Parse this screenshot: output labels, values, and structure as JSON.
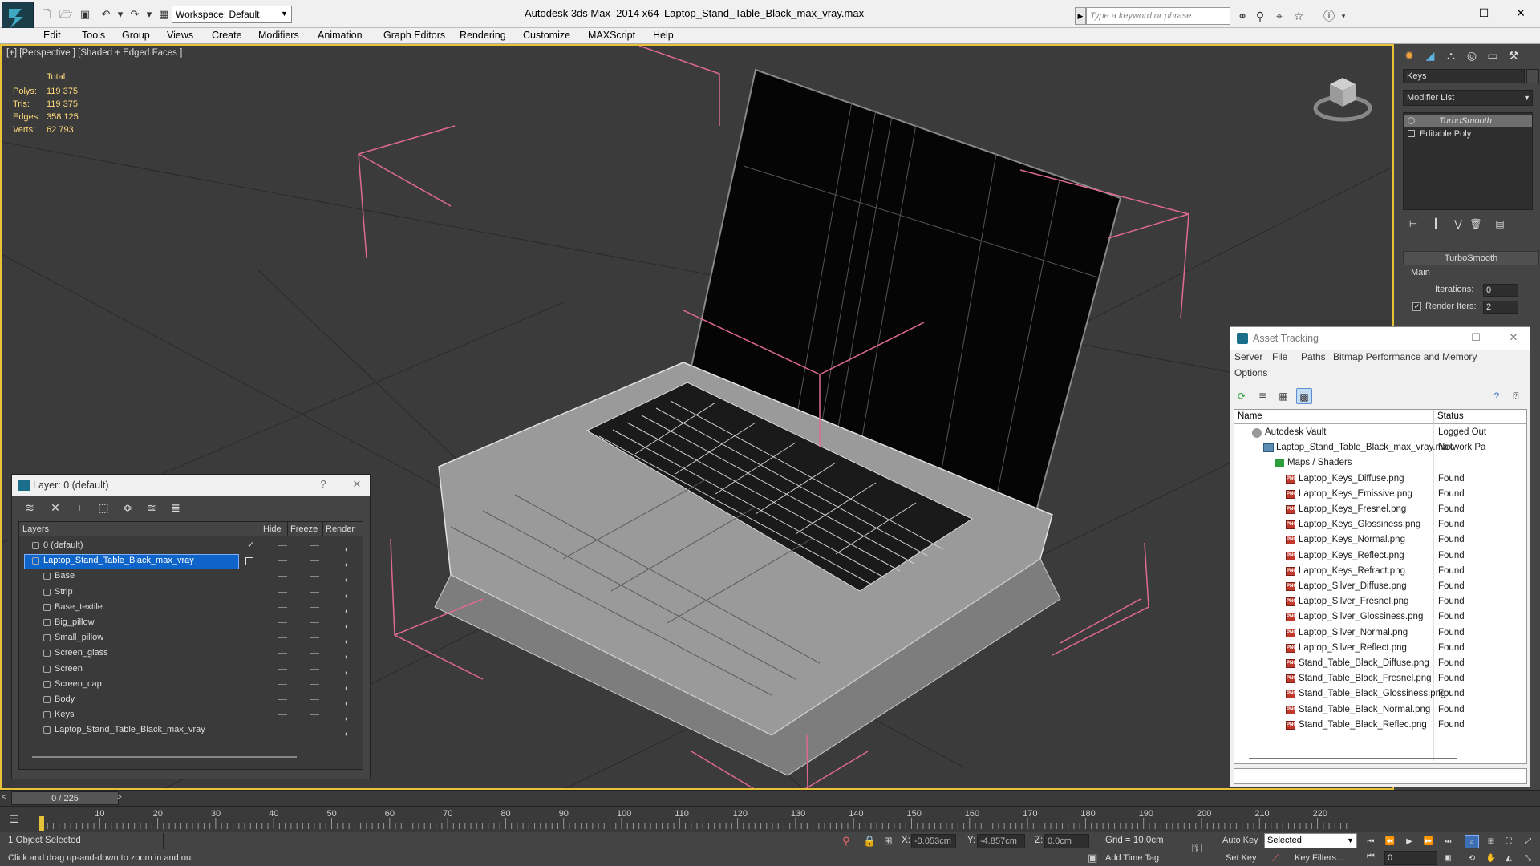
{
  "window": {
    "app_title": "Autodesk 3ds Max  2014 x64",
    "file_title": "Laptop_Stand_Table_Black_max_vray.max",
    "workspace": "Workspace: Default",
    "search_placeholder": "Type a keyword or phrase"
  },
  "menu": [
    "Edit",
    "Tools",
    "Group",
    "Views",
    "Create",
    "Modifiers",
    "Animation",
    "Graph Editors",
    "Rendering",
    "Customize",
    "MAXScript",
    "Help"
  ],
  "viewport": {
    "label": "[+] [Perspective ] [Shaded + Edged Faces ]",
    "stats_header": "Total",
    "stats": [
      {
        "label": "Polys:",
        "value": "119 375"
      },
      {
        "label": "Tris:",
        "value": "119 375"
      },
      {
        "label": "Edges:",
        "value": "358 125"
      },
      {
        "label": "Verts:",
        "value": "62 793"
      }
    ]
  },
  "command_panel": {
    "keys_field": "Keys",
    "modifier_list": "Modifier List",
    "stack": [
      "TurboSmooth",
      "Editable Poly"
    ],
    "rollout_title": "TurboSmooth",
    "group_main": "Main",
    "iterations_label": "Iterations:",
    "iterations_value": "0",
    "render_iters_label": "Render Iters:",
    "render_iters_value": "2"
  },
  "asset_tracking": {
    "title": "Asset Tracking",
    "menu_row1": [
      "Server",
      "File",
      "Paths",
      "Bitmap Performance and Memory"
    ],
    "menu_row2": [
      "Options"
    ],
    "col_name": "Name",
    "col_status": "Status",
    "rows": [
      {
        "name": "Autodesk Vault",
        "status": "Logged Out",
        "kind": "vault",
        "indent": 0
      },
      {
        "name": "Laptop_Stand_Table_Black_max_vray.max",
        "status": "Network Pa",
        "kind": "max",
        "indent": 1
      },
      {
        "name": "Maps / Shaders",
        "status": "",
        "kind": "folder",
        "indent": 2
      },
      {
        "name": "Laptop_Keys_Diffuse.png",
        "status": "Found",
        "kind": "png",
        "indent": 3
      },
      {
        "name": "Laptop_Keys_Emissive.png",
        "status": "Found",
        "kind": "png",
        "indent": 3
      },
      {
        "name": "Laptop_Keys_Fresnel.png",
        "status": "Found",
        "kind": "png",
        "indent": 3
      },
      {
        "name": "Laptop_Keys_Glossiness.png",
        "status": "Found",
        "kind": "png",
        "indent": 3
      },
      {
        "name": "Laptop_Keys_Normal.png",
        "status": "Found",
        "kind": "png",
        "indent": 3
      },
      {
        "name": "Laptop_Keys_Reflect.png",
        "status": "Found",
        "kind": "png",
        "indent": 3
      },
      {
        "name": "Laptop_Keys_Refract.png",
        "status": "Found",
        "kind": "png",
        "indent": 3
      },
      {
        "name": "Laptop_Silver_Diffuse.png",
        "status": "Found",
        "kind": "png",
        "indent": 3
      },
      {
        "name": "Laptop_Silver_Fresnel.png",
        "status": "Found",
        "kind": "png",
        "indent": 3
      },
      {
        "name": "Laptop_Silver_Glossiness.png",
        "status": "Found",
        "kind": "png",
        "indent": 3
      },
      {
        "name": "Laptop_Silver_Normal.png",
        "status": "Found",
        "kind": "png",
        "indent": 3
      },
      {
        "name": "Laptop_Silver_Reflect.png",
        "status": "Found",
        "kind": "png",
        "indent": 3
      },
      {
        "name": "Stand_Table_Black_Diffuse.png",
        "status": "Found",
        "kind": "png",
        "indent": 3
      },
      {
        "name": "Stand_Table_Black_Fresnel.png",
        "status": "Found",
        "kind": "png",
        "indent": 3
      },
      {
        "name": "Stand_Table_Black_Glossiness.png",
        "status": "Found",
        "kind": "png",
        "indent": 3
      },
      {
        "name": "Stand_Table_Black_Normal.png",
        "status": "Found",
        "kind": "png",
        "indent": 3
      },
      {
        "name": "Stand_Table_Black_Reflec.png",
        "status": "Found",
        "kind": "png",
        "indent": 3
      }
    ]
  },
  "layer_dialog": {
    "title": "Layer: 0 (default)",
    "help": "?",
    "col_layers": "Layers",
    "col_hide": "Hide",
    "col_freeze": "Freeze",
    "col_render": "Render",
    "rows": [
      {
        "name": "0 (default)",
        "kind": "layer",
        "check": "✓"
      },
      {
        "name": "Laptop_Stand_Table_Black_max_vray",
        "kind": "layer",
        "selected": true
      },
      {
        "name": "Base",
        "kind": "object"
      },
      {
        "name": "Strip",
        "kind": "object"
      },
      {
        "name": "Base_textile",
        "kind": "object"
      },
      {
        "name": "Big_pillow",
        "kind": "object"
      },
      {
        "name": "Small_pillow",
        "kind": "object"
      },
      {
        "name": "Screen_glass",
        "kind": "object"
      },
      {
        "name": "Screen",
        "kind": "object"
      },
      {
        "name": "Screen_cap",
        "kind": "object"
      },
      {
        "name": "Body",
        "kind": "object"
      },
      {
        "name": "Keys",
        "kind": "object"
      },
      {
        "name": "Laptop_Stand_Table_Black_max_vray",
        "kind": "object"
      }
    ]
  },
  "timeline": {
    "frame": "0 / 225",
    "ticks": [
      "10",
      "20",
      "30",
      "40",
      "50",
      "60",
      "70",
      "80",
      "90",
      "100",
      "110",
      "120",
      "130",
      "140",
      "150",
      "160",
      "170",
      "180",
      "190",
      "200",
      "210",
      "220"
    ]
  },
  "status": {
    "selection": "1 Object Selected",
    "prompt": "Click and drag up-and-down to zoom in and out",
    "x_label": "X:",
    "x_value": "-0.053cm",
    "y_label": "Y:",
    "y_value": "-4.857cm",
    "z_label": "Z:",
    "z_value": "0.0cm",
    "grid": "Grid = 10.0cm",
    "add_time_tag": "Add Time Tag",
    "auto_key": "Auto Key",
    "set_key": "Set Key",
    "selected_dropdown": "Selected",
    "key_filters": "Key Filters...",
    "frame_field": "0"
  }
}
